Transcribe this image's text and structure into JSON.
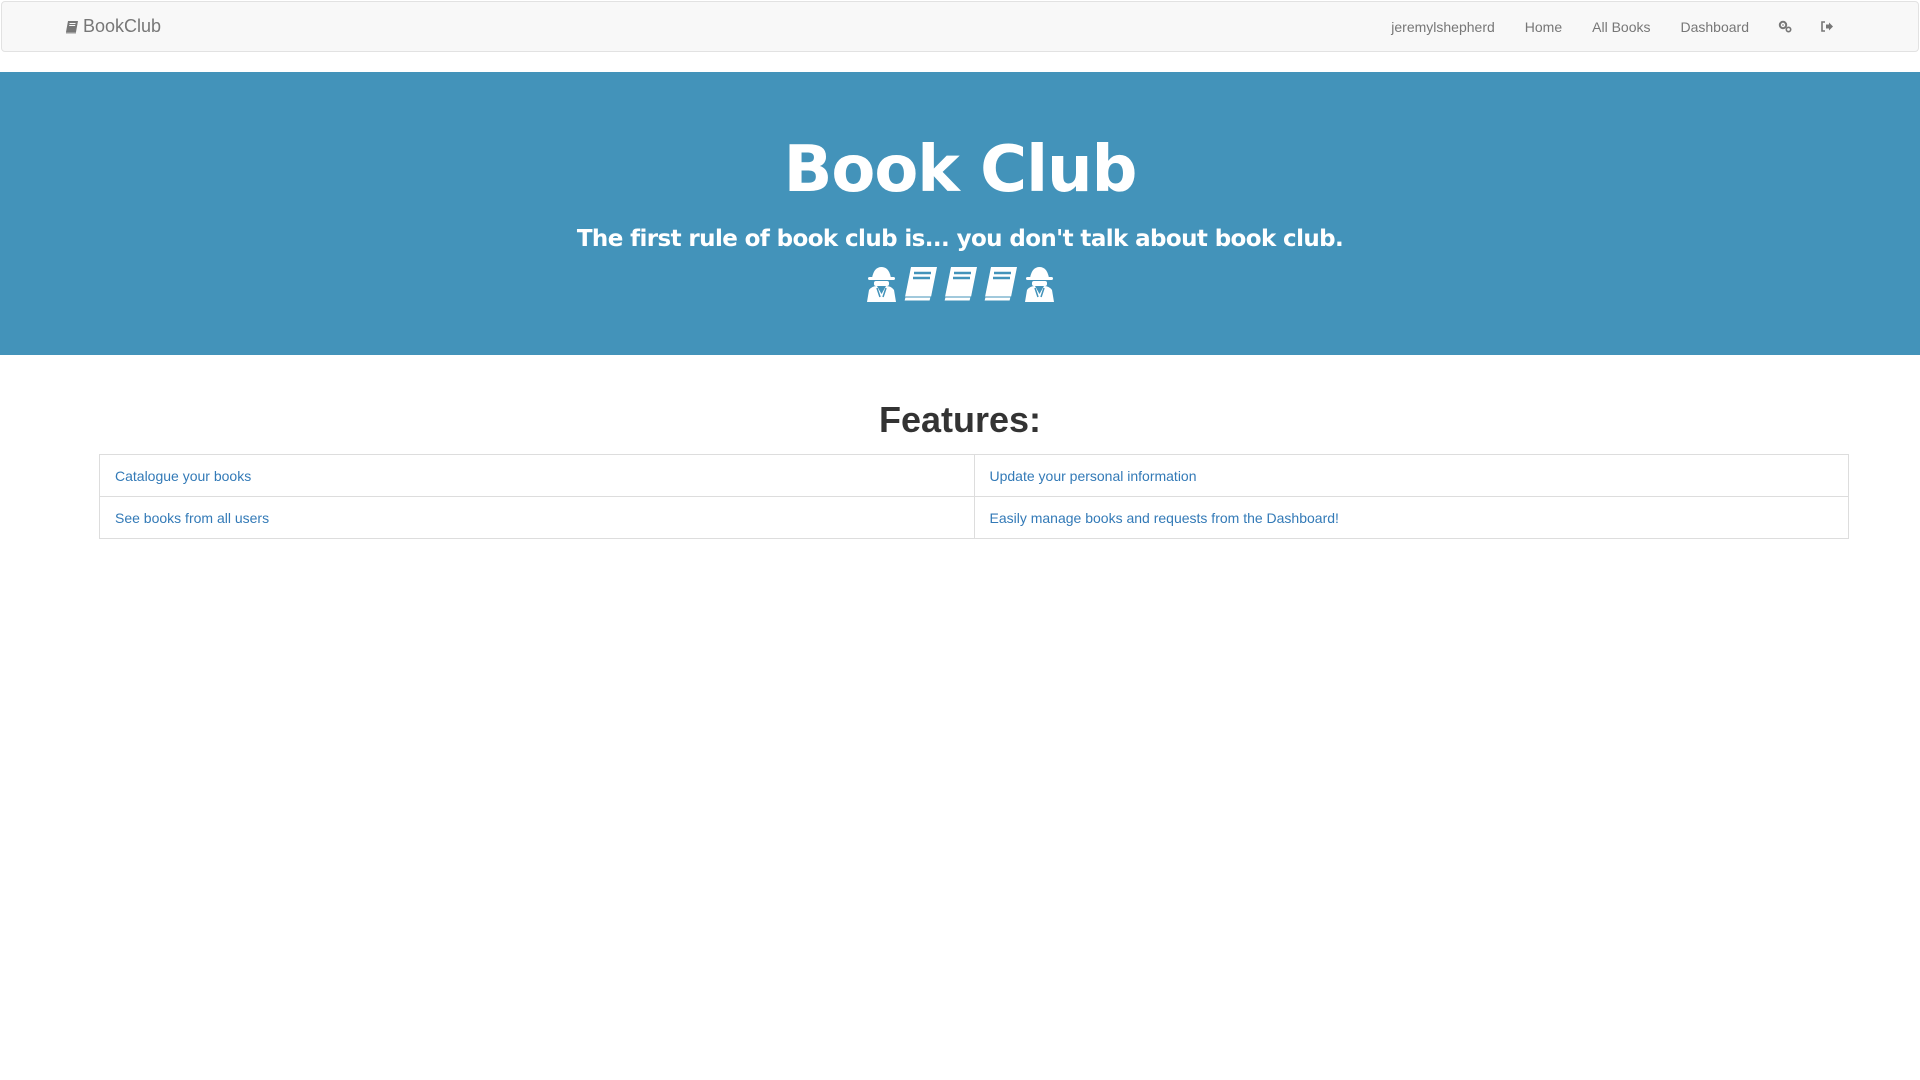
{
  "navbar": {
    "brand_label": "BookClub",
    "brand_icon": "book-icon",
    "links": {
      "username": "jeremylshepherd",
      "home": "Home",
      "all_books": "All Books",
      "dashboard": "Dashboard"
    },
    "settings_icon": "gears-icon",
    "logout_icon": "sign-out-icon"
  },
  "jumbotron": {
    "title": "Book Club",
    "subtitle": "The first rule of book club is... you don't talk about book club.",
    "icons": [
      "user-secret-icon",
      "book-icon",
      "book-icon",
      "book-icon",
      "user-secret-icon"
    ],
    "background_color": "#4393ba"
  },
  "features": {
    "heading": "Features:",
    "rows": [
      [
        "Catalogue your books",
        "Update your personal information"
      ],
      [
        "See books from all users",
        "Easily manage books and requests from the Dashboard!"
      ]
    ]
  },
  "colors": {
    "link": "#337ab7",
    "navbar_bg": "#f8f8f8",
    "navbar_text": "#777777"
  }
}
